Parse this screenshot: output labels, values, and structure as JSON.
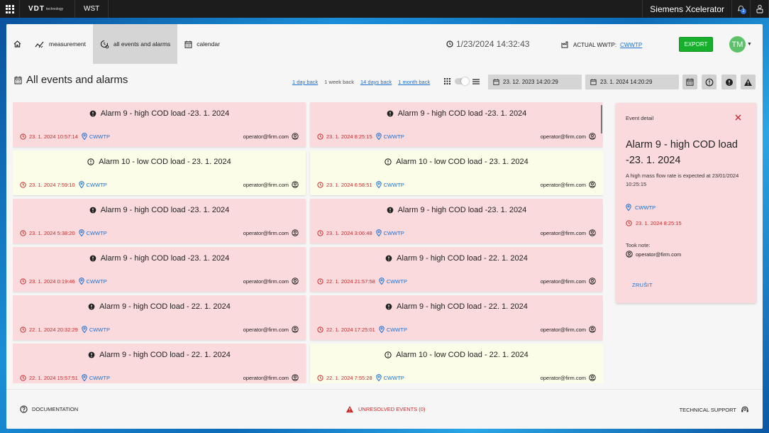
{
  "topbar": {
    "logo_main": "VDT",
    "logo_sub": "technology",
    "app_name": "WST",
    "brand": "Siemens Xcelerator",
    "notification_count": "2"
  },
  "nav": {
    "items": [
      {
        "label": "measurement",
        "icon": "measurement-icon"
      },
      {
        "label": "all events and alarms",
        "icon": "events-settings-icon",
        "active": true
      },
      {
        "label": "calendar",
        "icon": "calendar-icon"
      }
    ],
    "datetime": "1/23/2024 14:32:43",
    "wwtp_label": "ACTUAL WWTP:",
    "wwtp_value": "CWWTP",
    "export_label": "EXPORT",
    "user_initials": "TM"
  },
  "page": {
    "title": "All events and alarms"
  },
  "filters": {
    "range_links": [
      "1 day back",
      "1 week back",
      "14 days back",
      "1 month back"
    ],
    "active_range": "1 week back",
    "date_from": "23. 12. 2023 14:20:29",
    "date_to": "23. 1. 2024 14:20:29"
  },
  "events": [
    {
      "type": "alarm",
      "title": "Alarm 9 - high COD load -23. 1. 2024",
      "time": "23. 1. 2024 10:57:14",
      "location": "CWWTP",
      "user": "operator@firm.com"
    },
    {
      "type": "alarm",
      "title": "Alarm 9 - high COD load -23. 1. 2024",
      "time": "23. 1. 2024 8:25:15",
      "location": "CWWTP",
      "user": "operator@firm.com"
    },
    {
      "type": "warning",
      "title": "Alarm 10 - low COD load - 23. 1. 2024",
      "time": "23. 1. 2024 7:59:10",
      "location": "CWWTP",
      "user": "operator@firm.com"
    },
    {
      "type": "warning",
      "title": "Alarm 10 - low COD load - 23. 1. 2024",
      "time": "23. 1. 2024 6:58:51",
      "location": "CWWTP",
      "user": "operator@firm.com"
    },
    {
      "type": "alarm",
      "title": "Alarm 9 - high COD load -23. 1. 2024",
      "time": "23. 1. 2024 5:38:20",
      "location": "CWWTP",
      "user": "operator@firm.com"
    },
    {
      "type": "alarm",
      "title": "Alarm 9 - high COD load -23. 1. 2024",
      "time": "23. 1. 2024 3:06:48",
      "location": "CWWTP",
      "user": "operator@firm.com"
    },
    {
      "type": "alarm",
      "title": "Alarm 9 - high COD load -23. 1. 2024",
      "time": "23. 1. 2024 0:19:46",
      "location": "CWWTP",
      "user": "operator@firm.com"
    },
    {
      "type": "alarm",
      "title": "Alarm 9 - high COD load - 22. 1. 2024",
      "time": "22. 1. 2024 21:57:58",
      "location": "CWWTP",
      "user": "operator@firm.com"
    },
    {
      "type": "alarm",
      "title": "Alarm 9 - high COD load - 22. 1. 2024",
      "time": "22. 1. 2024 20:32:29",
      "location": "CWWTP",
      "user": "operator@firm.com"
    },
    {
      "type": "alarm",
      "title": "Alarm 9 - high COD load - 22. 1. 2024",
      "time": "22. 1. 2024 17:25:01",
      "location": "CWWTP",
      "user": "operator@firm.com"
    },
    {
      "type": "alarm",
      "title": "Alarm 9 - high COD load - 22. 1. 2024",
      "time": "22. 1. 2024 15:57:51",
      "location": "CWWTP",
      "user": "operator@firm.com"
    },
    {
      "type": "warning",
      "title": "Alarm 10 - low COD load - 22. 1. 2024",
      "time": "22. 1. 2024 7:55:28",
      "location": "CWWTP",
      "user": "operator@firm.com"
    }
  ],
  "detail": {
    "header": "Event detail",
    "title": "Alarm 9 - high COD load -23. 1. 2024",
    "description": "A high mass flow rate is expected at 23/01/2024 10:25:15",
    "location": "CWWTP",
    "time": "23. 1. 2024 8:25:15",
    "note_label": "Took note:",
    "note_user": "operator@firm.com",
    "cancel_label": "ZRUŠIT"
  },
  "footer": {
    "documentation": "DOCUMENTATION",
    "unresolved": "UNRESOLVED EVENTS (0)",
    "support": "TECHNICAL SUPPORT"
  },
  "colors": {
    "alarm_bg": "#fbdadd",
    "warning_bg": "#fcfde8",
    "accent_blue": "#1a6fd0",
    "alarm_red": "#c62828",
    "export_green": "#16b02d",
    "avatar_green": "#5cc16a"
  }
}
